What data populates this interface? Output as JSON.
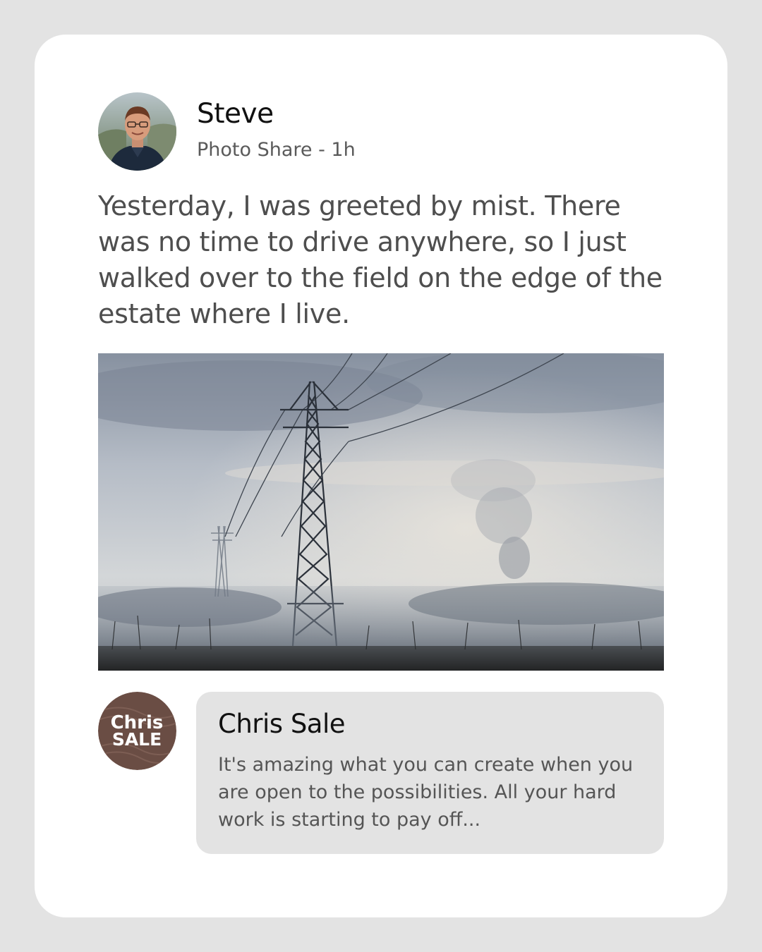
{
  "post": {
    "author": "Steve",
    "meta": "Photo Share - 1h",
    "text": "Yesterday, I was greeted by mist. There was no time to drive anywhere, so I just walked over to the field on the edge of the estate where I live."
  },
  "comment": {
    "author": "Chris Sale",
    "logo_line1": "Chris",
    "logo_line2": "SALE",
    "text": "It's amazing what you can create when you are open to the possibilities. All your hard work is starting to pay off..."
  },
  "colors": {
    "page_background": "#e3e3e3",
    "card_background": "#ffffff",
    "comment_bubble": "#e3e3e3",
    "logo_brown": "#6a4d44"
  }
}
